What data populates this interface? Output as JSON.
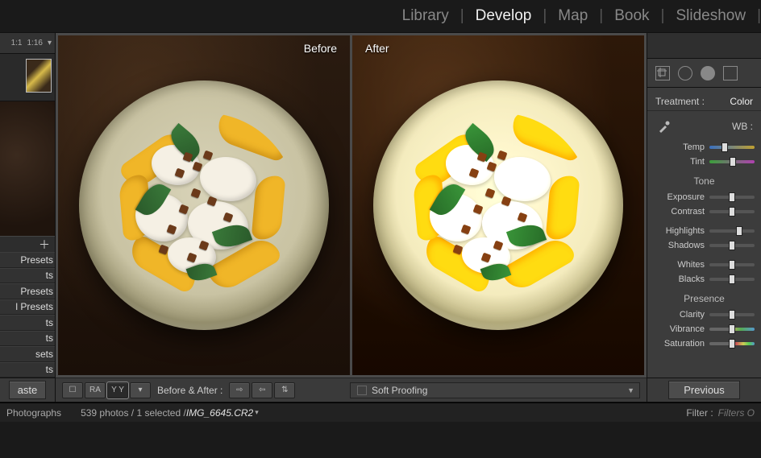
{
  "modules": {
    "items": [
      "Library",
      "Develop",
      "Map",
      "Book",
      "Slideshow"
    ],
    "active": "Develop"
  },
  "navigator": {
    "ratios": [
      "1:1",
      "1:16"
    ],
    "chevron": "▾"
  },
  "presets": {
    "header": "Presets",
    "rows": [
      "ts",
      "Presets",
      "l Presets",
      "ts",
      "ts",
      "sets",
      "ts"
    ]
  },
  "paste_label": "aste",
  "preview": {
    "before_label": "Before",
    "after_label": "After"
  },
  "toolbar": {
    "view_buttons": [
      "☐",
      "RA",
      "Y Y",
      "▾"
    ],
    "before_after_label": "Before & After :",
    "nav_icons": [
      "⇨",
      "⇦",
      "⇅"
    ],
    "soft_proofing_label": "Soft Proofing"
  },
  "tools_row": {
    "icons": [
      "crop",
      "circle-outline",
      "circle-filled",
      "rect"
    ]
  },
  "basic": {
    "treatment_label": "Treatment :",
    "treatment_value": "Color",
    "wb_label": "WB :",
    "sliders_wb": [
      {
        "label": "Temp",
        "pos": 32,
        "type": "temp"
      },
      {
        "label": "Tint",
        "pos": 52,
        "type": "tint"
      }
    ],
    "tone_label": "Tone",
    "sliders_tone": [
      {
        "label": "Exposure",
        "pos": 50
      },
      {
        "label": "Contrast",
        "pos": 50
      },
      {
        "label": "Highlights",
        "pos": 68
      },
      {
        "label": "Shadows",
        "pos": 50
      },
      {
        "label": "Whites",
        "pos": 50
      },
      {
        "label": "Blacks",
        "pos": 50
      }
    ],
    "presence_label": "Presence",
    "sliders_presence": [
      {
        "label": "Clarity",
        "pos": 50
      },
      {
        "label": "Vibrance",
        "pos": 50,
        "type": "vib"
      },
      {
        "label": "Saturation",
        "pos": 50,
        "type": "sat"
      }
    ]
  },
  "previous_label": "Previous",
  "status": {
    "collection": "Photographs",
    "count_text": "539 photos / 1 selected /",
    "filename": "IMG_6645.CR2",
    "caret": "▾",
    "filter_label": "Filter :",
    "filter_value": "Filters O"
  }
}
